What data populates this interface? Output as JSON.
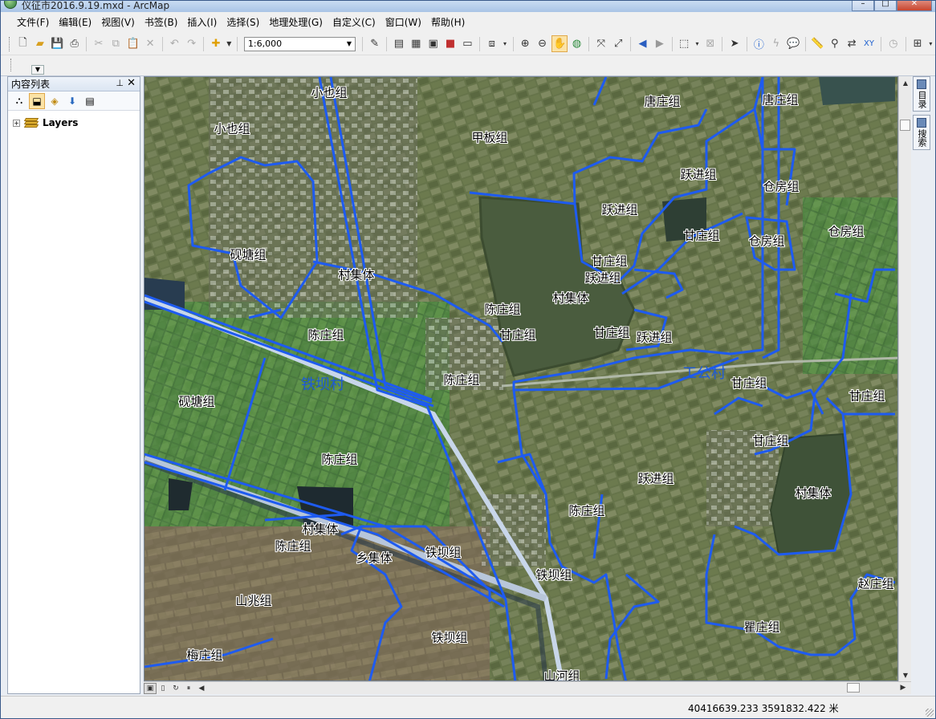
{
  "titlebar": {
    "title": "仪征市2016.9.19.mxd - ArcMap"
  },
  "menu": [
    "文件(F)",
    "编辑(E)",
    "视图(V)",
    "书签(B)",
    "插入(I)",
    "选择(S)",
    "地理处理(G)",
    "自定义(C)",
    "窗口(W)",
    "帮助(H)"
  ],
  "toolbar": {
    "scale_value": "1:6,000"
  },
  "toc": {
    "title": "内容列表",
    "root_layer": "Layers"
  },
  "side_tabs": [
    "目录",
    "搜索"
  ],
  "status": {
    "coordinates": "40416639.233  3591832.422 米"
  },
  "map": {
    "labels": [
      {
        "id": "xiaoye-1",
        "text": "小也组"
      },
      {
        "id": "xiaoye-2",
        "text": "小也组"
      },
      {
        "id": "jiaban",
        "text": "甲板组"
      },
      {
        "id": "tangzhuang-1",
        "text": "唐庄组"
      },
      {
        "id": "tangzhuang-2",
        "text": "唐庄组"
      },
      {
        "id": "yuejin-1",
        "text": "跃进组"
      },
      {
        "id": "cangfang-1",
        "text": "仓房组"
      },
      {
        "id": "yuejin-2",
        "text": "跃进组"
      },
      {
        "id": "ganzhuang-1",
        "text": "甘庄组"
      },
      {
        "id": "cangfang-2",
        "text": "仓房组"
      },
      {
        "id": "cangfang-3",
        "text": "仓房组"
      },
      {
        "id": "yantang-1",
        "text": "砚塘组"
      },
      {
        "id": "cunjiti-1",
        "text": "村集体"
      },
      {
        "id": "ganzhuang-2",
        "text": "甘庄组"
      },
      {
        "id": "yuejin-3",
        "text": "跃进组"
      },
      {
        "id": "chenzhuang-1",
        "text": "陈庄组"
      },
      {
        "id": "cunjiti-2",
        "text": "村集体"
      },
      {
        "id": "chenzhuang-2",
        "text": "陈庄组"
      },
      {
        "id": "ganzhuang-3",
        "text": "甘庄组"
      },
      {
        "id": "ganzhuang-4",
        "text": "甘庄组"
      },
      {
        "id": "yuejin-4",
        "text": "跃进组"
      },
      {
        "id": "chenzhuang-3",
        "text": "陈庄组"
      },
      {
        "id": "ganzhuang-5",
        "text": "甘庄组"
      },
      {
        "id": "ganzhuang-6",
        "text": "甘庄组"
      },
      {
        "id": "yantang-2",
        "text": "砚塘组"
      },
      {
        "id": "ganzhuang-7",
        "text": "甘庄组"
      },
      {
        "id": "chenzhuang-4",
        "text": "陈庄组"
      },
      {
        "id": "yuejin-5",
        "text": "跃进组"
      },
      {
        "id": "cunjiti-3",
        "text": "村集体"
      },
      {
        "id": "chenzhuang-5",
        "text": "陈庄组"
      },
      {
        "id": "cunjiti-4",
        "text": "村集体"
      },
      {
        "id": "chenzhuang-6",
        "text": "陈庄组"
      },
      {
        "id": "xiangjiti",
        "text": "乡集体"
      },
      {
        "id": "tieba-1",
        "text": "铁坝组"
      },
      {
        "id": "tieba-2",
        "text": "铁坝组"
      },
      {
        "id": "zhaozhuang",
        "text": "赵庄组"
      },
      {
        "id": "shanzhao",
        "text": "山兆组"
      },
      {
        "id": "quzhuang",
        "text": "瞿庄组"
      },
      {
        "id": "tieba-3",
        "text": "铁坝组"
      },
      {
        "id": "meizhuang",
        "text": "梅庄组"
      },
      {
        "id": "shanhe",
        "text": "山河组"
      }
    ],
    "villages": [
      {
        "id": "tieba-cun",
        "text": "铁坝村"
      },
      {
        "id": "gonggong-cun",
        "text": "工公村"
      }
    ]
  }
}
